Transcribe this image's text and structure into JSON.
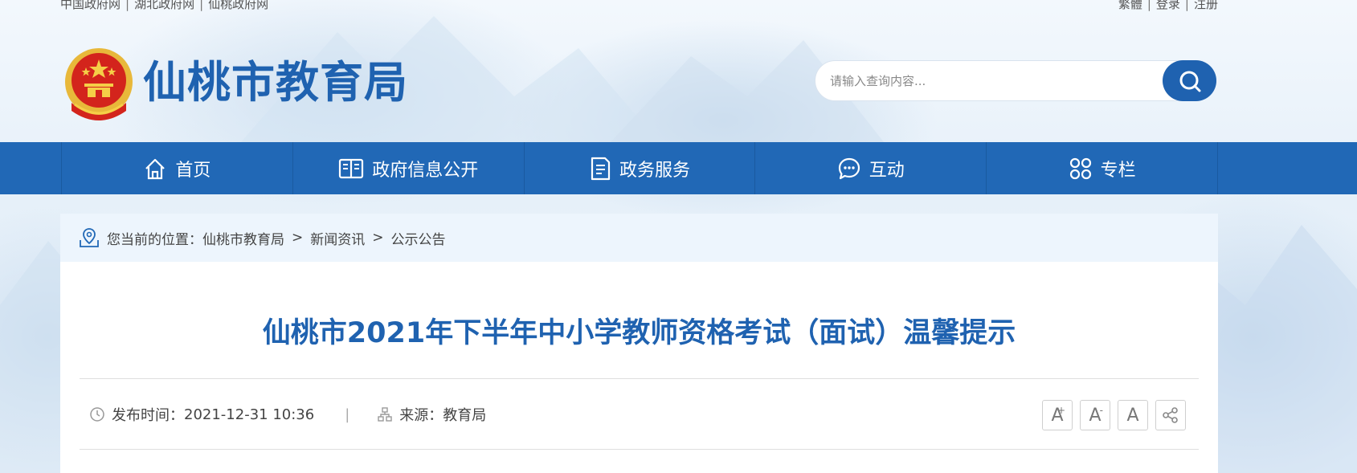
{
  "top_links": {
    "left": [
      "中国政府网",
      "湖北政府网",
      "仙桃政府网"
    ],
    "right": [
      "繁體",
      "登录",
      "注册"
    ]
  },
  "site": {
    "title": "仙桃市教育局"
  },
  "search": {
    "placeholder": "请输入查询内容..."
  },
  "nav": [
    {
      "label": "首页",
      "icon": "home-icon"
    },
    {
      "label": "政府信息公开",
      "icon": "book-icon"
    },
    {
      "label": "政务服务",
      "icon": "document-icon"
    },
    {
      "label": "互动",
      "icon": "chat-icon"
    },
    {
      "label": "专栏",
      "icon": "grid-icon"
    }
  ],
  "breadcrumb": {
    "prefix": "您当前的位置：",
    "items": [
      "仙桃市教育局",
      "新闻资讯",
      "公示公告"
    ]
  },
  "article": {
    "title": "仙桃市2021年下半年中小学教师资格考试（面试）温馨提示",
    "publish_label": "发布时间：",
    "publish_time": "2021-12-31 10:36",
    "source_label": "来源：",
    "source": "教育局",
    "divider": "|"
  },
  "tools": {
    "increase": "A",
    "decrease": "A",
    "reset": "A",
    "increase_sup": "+",
    "decrease_sup": "-"
  },
  "colors": {
    "brand": "#1f62b0",
    "nav_bg": "#2168b6",
    "crumb_bg": "#edf5fd"
  }
}
